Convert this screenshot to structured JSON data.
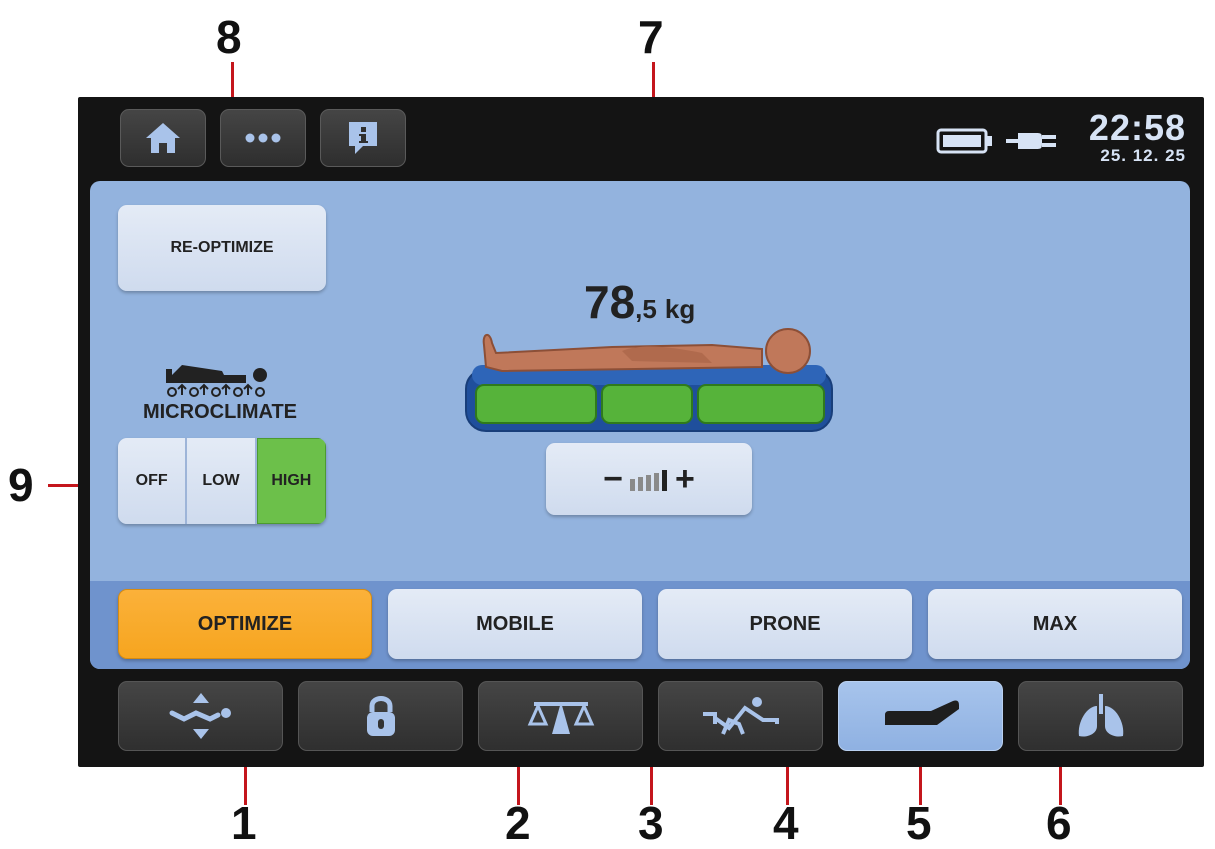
{
  "callouts": {
    "c1": "1",
    "c2": "2",
    "c3": "3",
    "c4": "4",
    "c5": "5",
    "c6": "6",
    "c7": "7",
    "c8": "8",
    "c9": "9"
  },
  "topbar": {
    "time": "22:58",
    "date": "25. 12. 25",
    "buttons": [
      "home-icon",
      "more-dots-icon",
      "info-icon"
    ],
    "status_icons": [
      "battery-icon",
      "power-plug-icon"
    ]
  },
  "main": {
    "reoptimize_label": "RE-OPTIMIZE",
    "weight_whole": "78",
    "weight_fraction": ",5",
    "weight_unit": "kg",
    "microclimate": {
      "title": "MICROCLIMATE",
      "options": [
        "OFF",
        "LOW",
        "HIGH"
      ],
      "selected": "HIGH"
    },
    "firmness_adjust": {
      "minus": "−",
      "plus": "+",
      "level": 5,
      "max": 5
    }
  },
  "modes": {
    "items": [
      "OPTIMIZE",
      "MOBILE",
      "PRONE",
      "MAX"
    ],
    "active": "OPTIMIZE"
  },
  "bottom_nav": {
    "icons": [
      "bed-height-icon",
      "lock-icon",
      "scale-icon",
      "bed-positions-icon",
      "mattress-icon",
      "lungs-icon"
    ],
    "active": "mattress-icon"
  },
  "colors": {
    "panel": "#93b3de",
    "mode_strip": "#6f93cd",
    "active_mode": "#f6a51f",
    "active_segment": "#6cc04a",
    "mattress_zone": "#56b33a",
    "callout_line": "#c4161c"
  }
}
